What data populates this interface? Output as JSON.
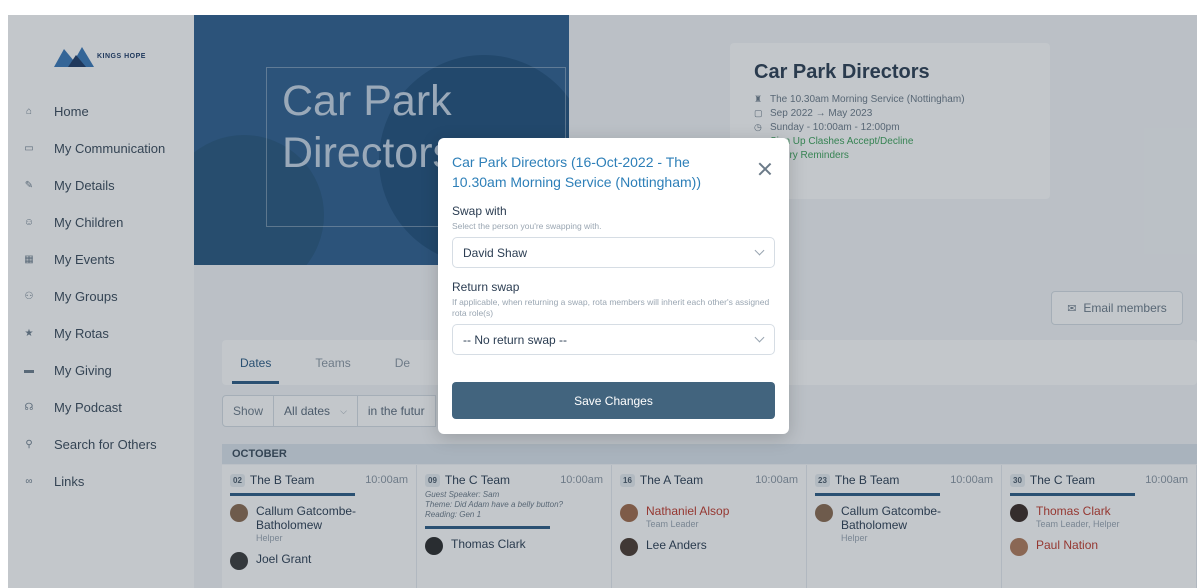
{
  "logo": {
    "text": "KINGS HOPE"
  },
  "sidebar": {
    "items": [
      {
        "label": "Home",
        "icon": "home-icon"
      },
      {
        "label": "My Communication",
        "icon": "chat-icon"
      },
      {
        "label": "My Details",
        "icon": "pencil-icon"
      },
      {
        "label": "My Children",
        "icon": "child-icon"
      },
      {
        "label": "My Events",
        "icon": "calendar-icon"
      },
      {
        "label": "My Groups",
        "icon": "group-icon"
      },
      {
        "label": "My Rotas",
        "icon": "star-icon"
      },
      {
        "label": "My Giving",
        "icon": "card-icon"
      },
      {
        "label": "My Podcast",
        "icon": "headphones-icon"
      },
      {
        "label": "Search for Others",
        "icon": "search-people-icon"
      },
      {
        "label": "Links",
        "icon": "link-icon"
      }
    ]
  },
  "banner": {
    "line1": "Car Park",
    "line2": "Directors"
  },
  "info": {
    "title": "Car Park Directors",
    "service": "The 10.30am Morning Service (Nottingham)",
    "dates": "Sep 2022 → May 2023",
    "schedule": "Sunday - 10:00am - 12:00pm",
    "links1": "Sign Up Clashes Accept/Decline",
    "links2": "Expiry Reminders"
  },
  "email_button": "Email members",
  "tabs": [
    "Dates",
    "Teams",
    "De"
  ],
  "filter": {
    "show": "Show",
    "dates": "All dates",
    "future": "in the futur"
  },
  "month": "OCTOBER",
  "columns": [
    {
      "date": "02",
      "team": "The B Team",
      "time": "10:00am",
      "note": "",
      "people": [
        {
          "name": "Callum Gatcombe-Batholomew",
          "role": "Helper",
          "red": false
        },
        {
          "name": "Joel Grant",
          "role": "",
          "red": false
        }
      ]
    },
    {
      "date": "09",
      "team": "The C Team",
      "time": "10:00am",
      "note": "Guest Speaker: Sam\nTheme: Did Adam have a belly button?\nReading: Gen 1",
      "people": [
        {
          "name": "Thomas Clark",
          "role": "",
          "red": false
        }
      ]
    },
    {
      "date": "16",
      "team": "The A Team",
      "time": "10:00am",
      "note": "",
      "people": [
        {
          "name": "Nathaniel Alsop",
          "role": "Team Leader",
          "red": true
        },
        {
          "name": "Lee Anders",
          "role": "",
          "red": false
        }
      ]
    },
    {
      "date": "23",
      "team": "The B Team",
      "time": "10:00am",
      "note": "",
      "people": [
        {
          "name": "Callum Gatcombe-Batholomew",
          "role": "Helper",
          "red": false
        }
      ]
    },
    {
      "date": "30",
      "team": "The C Team",
      "time": "10:00am",
      "note": "",
      "people": [
        {
          "name": "Thomas Clark",
          "role": "Team Leader, Helper",
          "red": true
        },
        {
          "name": "Paul Nation",
          "role": "",
          "red": true
        }
      ]
    }
  ],
  "modal": {
    "title": "Car Park Directors (16-Oct-2022 - The 10.30am Morning Service (Nottingham))",
    "swap_label": "Swap with",
    "swap_help": "Select the person you're swapping with.",
    "swap_value": "David Shaw",
    "return_label": "Return swap",
    "return_help": "If applicable, when returning a swap, rota members will inherit each other's assigned rota role(s)",
    "return_value": "-- No return swap --",
    "save_label": "Save Changes"
  },
  "colors": {
    "accent": "#2d7fb8",
    "button": "#42647e",
    "green": "#3da25a",
    "red": "#c0392b"
  }
}
